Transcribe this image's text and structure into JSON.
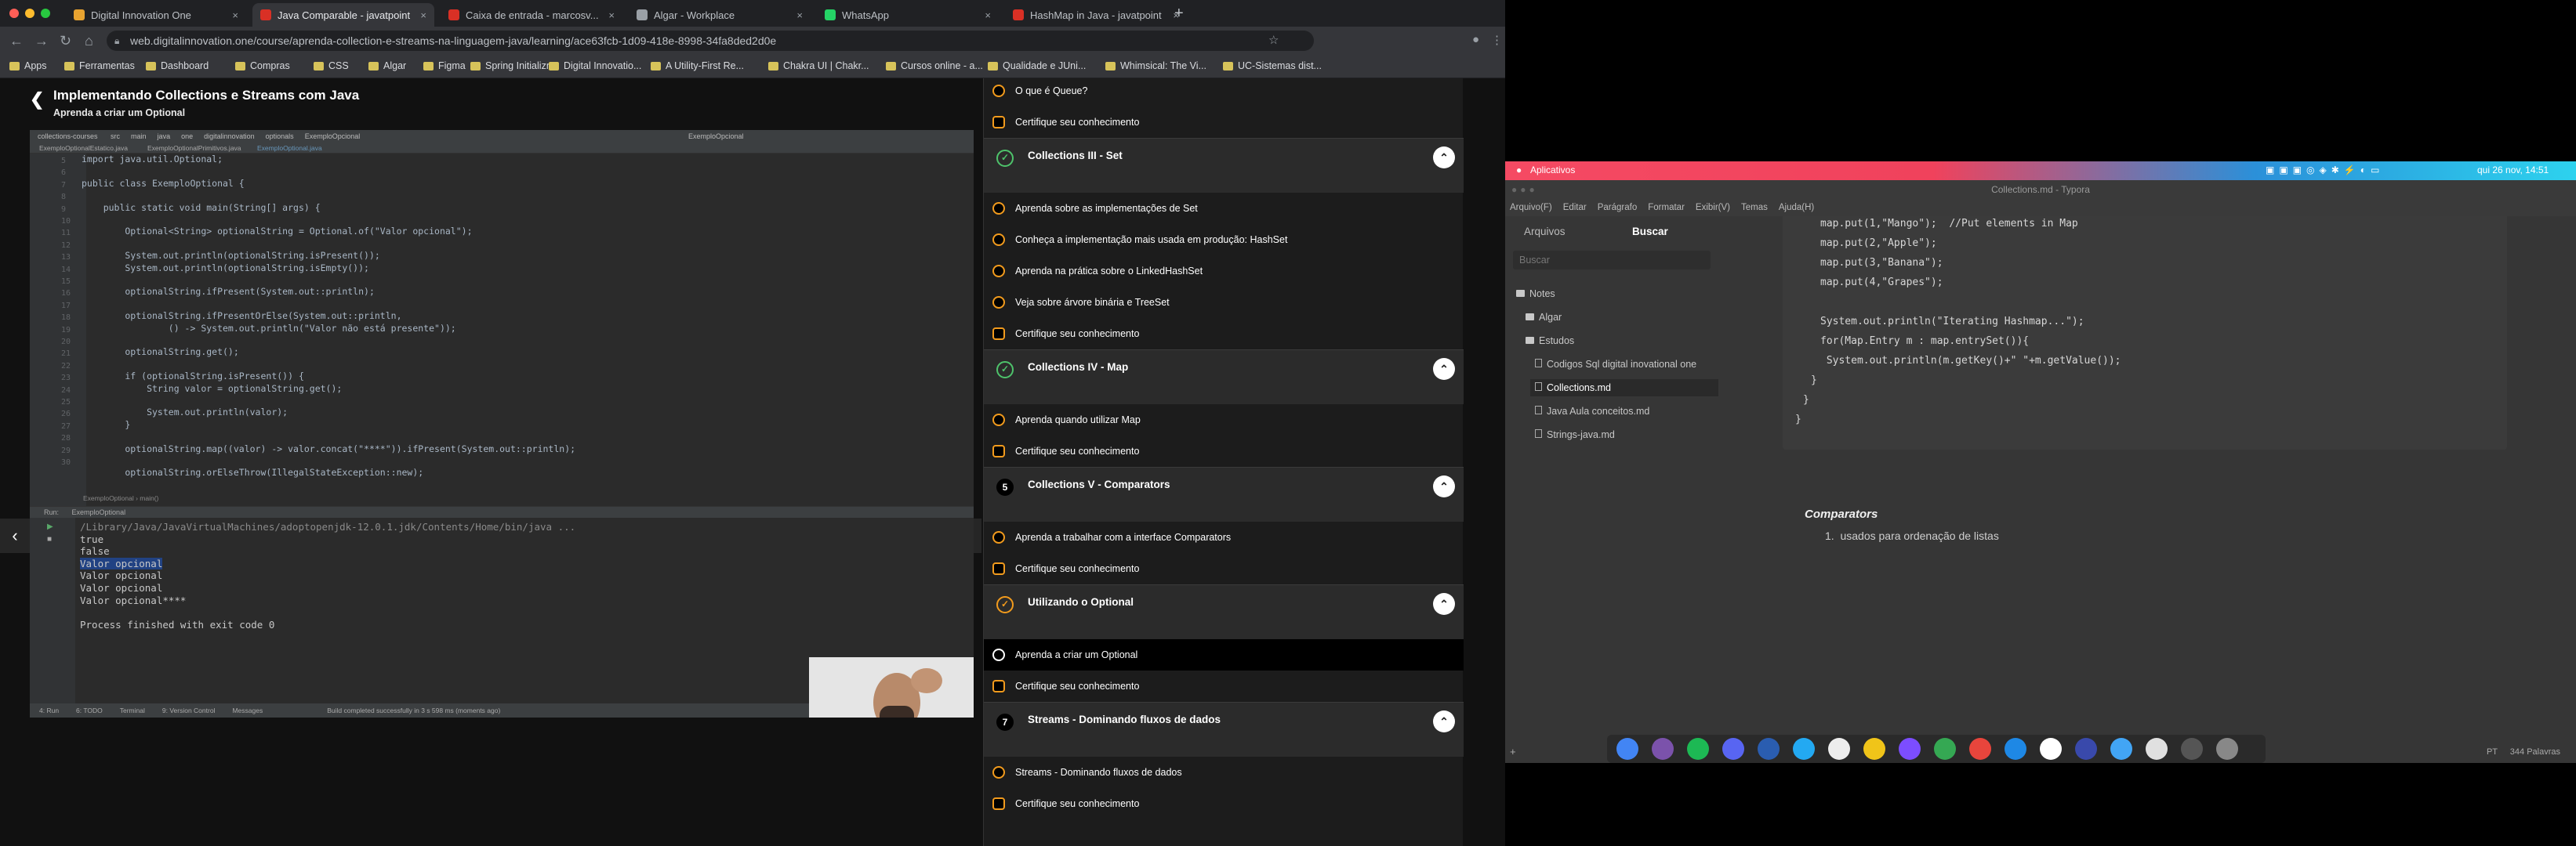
{
  "browser": {
    "tabs": [
      {
        "title": "Digital Innovation One",
        "color": "#e8a330"
      },
      {
        "title": "Java Comparable - javatpoint",
        "color": "#d93025"
      },
      {
        "title": "Caixa de entrada - marcosv...",
        "color": "#d93025"
      },
      {
        "title": "Algar - Workplace",
        "color": "#9aa0a6"
      },
      {
        "title": "WhatsApp",
        "color": "#25d366"
      },
      {
        "title": "HashMap in Java - javatpoint",
        "color": "#d93025"
      }
    ],
    "new_tab": "+",
    "url": "web.digitalinnovation.one/course/aprenda-collection-e-streams-na-linguagem-java/learning/ace63fcb-1d09-418e-8998-34fa8ded2d0e",
    "bookmarks": [
      "Apps",
      "Ferramentas",
      "Dashboard",
      "Compras",
      "CSS",
      "Algar",
      "Figma",
      "Spring Initializr",
      "Digital Innovatio...",
      "A Utility-First Re...",
      "Chakra UI | Chakr...",
      "Cursos online - a...",
      "Qualidade e JUni...",
      "Whimsical: The Vi...",
      "UC-Sistemas dist..."
    ]
  },
  "course": {
    "title": "Implementando Collections e Streams com Java",
    "subtitle": "Aprenda a criar um Optional"
  },
  "ide": {
    "project": "collections-courses",
    "crumbs": [
      "src",
      "main",
      "java",
      "one",
      "digitalinnovation",
      "optionals",
      "ExemploOpcional"
    ],
    "run_config": "ExemploOpcional",
    "file_tabs": [
      "ExemploOptionalEstatico.java",
      "ExemploOptionalPrimitivos.java",
      "ExemploOptional.java"
    ],
    "line_numbers": [
      "5",
      "6",
      "7",
      "8",
      "9",
      "10",
      "11",
      "12",
      "13",
      "14",
      "15",
      "16",
      "17",
      "18",
      "19",
      "20",
      "21",
      "22",
      "23",
      "24",
      "25",
      "26",
      "27",
      "28",
      "29",
      "30"
    ],
    "code_lines": [
      "import java.util.Optional;",
      "",
      "public class ExemploOptional {",
      "",
      "    public static void main(String[] args) {",
      "",
      "        Optional<String> optionalString = Optional.of(\"Valor opcional\");",
      "",
      "        System.out.println(optionalString.isPresent());",
      "        System.out.println(optionalString.isEmpty());",
      "",
      "        optionalString.ifPresent(System.out::println);",
      "",
      "        optionalString.ifPresentOrElse(System.out::println,",
      "                () -> System.out.println(\"Valor não está presente\"));",
      "",
      "        optionalString.get();",
      "",
      "        if (optionalString.isPresent()) {",
      "            String valor = optionalString.get();",
      "",
      "            System.out.println(valor);",
      "        }",
      "",
      "        optionalString.map((valor) -> valor.concat(\"****\")).ifPresent(System.out::println);",
      "",
      "        optionalString.orElseThrow(IllegalStateException::new);"
    ],
    "breadcrumb_bottom": [
      "ExemploOptional",
      "main()"
    ],
    "run_tab": "Run:",
    "run_name": "ExemploOptional",
    "output": [
      "/Library/Java/JavaVirtualMachines/adoptopenjdk-12.0.1.jdk/Contents/Home/bin/java ...",
      "true",
      "false",
      "Valor opcional",
      "Valor opcional",
      "Valor opcional",
      "Valor opcional****",
      "",
      "Process finished with exit code 0"
    ],
    "bottom_tabs": [
      "4: Run",
      "6: TODO",
      "Terminal",
      "9: Version Control",
      "Messages"
    ],
    "status": "Build completed successfully in 3 s 598 ms (moments ago)"
  },
  "sidebar": {
    "items": [
      {
        "kind": "lesson",
        "label": "O que é Queue?",
        "icon": "play-icon"
      },
      {
        "kind": "lesson",
        "label": "Certifique seu conhecimento",
        "icon": "quiz-icon"
      },
      {
        "kind": "module",
        "label": "Collections III - Set",
        "badge": "check"
      },
      {
        "kind": "lesson",
        "label": "Aprenda sobre as implementações de Set",
        "icon": "play-icon"
      },
      {
        "kind": "lesson",
        "label": "Conheça a implementação mais usada em produção: HashSet",
        "icon": "play-icon"
      },
      {
        "kind": "lesson",
        "label": "Aprenda na prática sobre o LinkedHashSet",
        "icon": "play-icon"
      },
      {
        "kind": "lesson",
        "label": "Veja sobre árvore binária e TreeSet",
        "icon": "play-icon"
      },
      {
        "kind": "lesson",
        "label": "Certifique seu conhecimento",
        "icon": "quiz-icon"
      },
      {
        "kind": "module",
        "label": "Collections IV - Map",
        "badge": "check"
      },
      {
        "kind": "lesson",
        "label": "Aprenda quando utilizar Map",
        "icon": "play-icon"
      },
      {
        "kind": "lesson",
        "label": "Certifique seu conhecimento",
        "icon": "quiz-icon"
      },
      {
        "kind": "module",
        "label": "Collections V - Comparators",
        "badge": "5"
      },
      {
        "kind": "lesson",
        "label": "Aprenda a trabalhar com a interface Comparators",
        "icon": "play-icon"
      },
      {
        "kind": "lesson",
        "label": "Certifique seu conhecimento",
        "icon": "quiz-icon"
      },
      {
        "kind": "module",
        "label": "Utilizando o Optional",
        "badge": "partial"
      },
      {
        "kind": "lesson",
        "label": "Aprenda a criar um Optional",
        "icon": "play-icon",
        "active": true
      },
      {
        "kind": "lesson",
        "label": "Certifique seu conhecimento",
        "icon": "quiz-icon"
      },
      {
        "kind": "module",
        "label": "Streams - Dominando fluxos de dados",
        "badge": "7"
      },
      {
        "kind": "lesson",
        "label": "Streams - Dominando fluxos de dados",
        "icon": "play-icon"
      },
      {
        "kind": "lesson",
        "label": "Certifique seu conhecimento",
        "icon": "quiz-icon"
      }
    ]
  },
  "desktop": {
    "topbar_app": "Aplicativos",
    "clock": "qui 26 nov, 14:51",
    "window_title": "Collections.md - Typora",
    "menu": [
      "Arquivo(F)",
      "Editar",
      "Parágrafo",
      "Formatar",
      "Exibir(V)",
      "Temas",
      "Ajuda(H)"
    ],
    "side_tabs": [
      "Arquivos",
      "Buscar"
    ],
    "search_placeholder": "Buscar",
    "tree": [
      {
        "label": "Notes",
        "type": "folder",
        "indent": 0
      },
      {
        "label": "Algar",
        "type": "folder",
        "indent": 1
      },
      {
        "label": "Estudos",
        "type": "folder",
        "indent": 1
      },
      {
        "label": "Codigos Sql digital inovational one",
        "type": "file",
        "indent": 2
      },
      {
        "label": "Collections.md",
        "type": "file",
        "indent": 2,
        "selected": true
      },
      {
        "label": "Java Aula conceitos.md",
        "type": "file",
        "indent": 2
      },
      {
        "label": "Strings-java.md",
        "type": "file",
        "indent": 2
      }
    ],
    "code": [
      "map.put(1,\"Mango\");  //Put elements in Map",
      "map.put(2,\"Apple\");",
      "map.put(3,\"Banana\");",
      "map.put(4,\"Grapes\");",
      "",
      "System.out.println(\"Iterating Hashmap...\");",
      "for(Map.Entry m : map.entrySet()){",
      " System.out.println(m.getKey()+\" \"+m.getValue());",
      "}",
      "}",
      "}"
    ],
    "heading": "Comparators",
    "list_item": "usados para ordenação de listas",
    "word_count": "344 Palavras",
    "lang": "PT"
  }
}
